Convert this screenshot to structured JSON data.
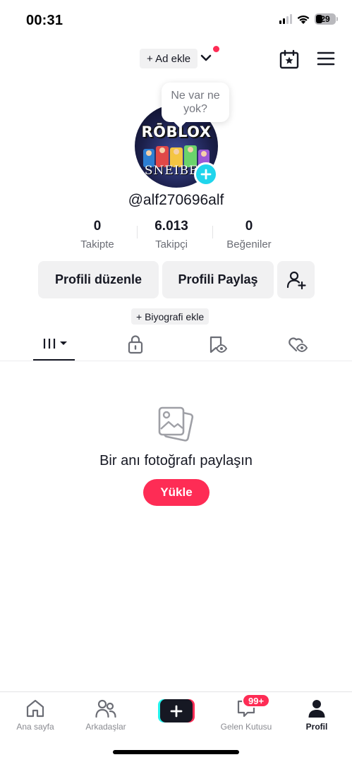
{
  "status_bar": {
    "time": "00:31",
    "battery": "29",
    "icons": [
      "signal-icon",
      "wifi-icon",
      "battery-icon"
    ]
  },
  "top_bar": {
    "add_account_label": "+ Ad ekle",
    "icons": [
      "chevron-down-icon",
      "notification-dot",
      "calendar-star-icon",
      "menu-icon"
    ]
  },
  "profile": {
    "bubble_text": "Ne var ne yok?",
    "avatar_brand": "RŌBLOX",
    "avatar_name": "SNEIBER",
    "username": "@alf270696alf",
    "stats": [
      {
        "value": "0",
        "label": "Takipte"
      },
      {
        "value": "6.013",
        "label": "Takipçi"
      },
      {
        "value": "0",
        "label": "Beğeniler"
      }
    ],
    "buttons": {
      "edit": "Profili düzenle",
      "share": "Profili Paylaş"
    },
    "bio_button": "+ Biyografi ekle"
  },
  "tabs": [
    {
      "name": "videos",
      "icon": "grid-icon",
      "active": true
    },
    {
      "name": "private",
      "icon": "lock-icon",
      "active": false
    },
    {
      "name": "saved",
      "icon": "bookmark-eye-icon",
      "active": false
    },
    {
      "name": "liked",
      "icon": "heart-eye-icon",
      "active": false
    }
  ],
  "empty_state": {
    "title": "Bir anı fotoğrafı paylaşın",
    "button": "Yükle",
    "icon": "photos-icon"
  },
  "bottom_nav": {
    "items": [
      {
        "label": "Ana sayfa",
        "icon": "home-icon"
      },
      {
        "label": "Arkadaşlar",
        "icon": "friends-icon"
      },
      {
        "label": "",
        "icon": "create-plus-icon"
      },
      {
        "label": "Gelen Kutusu",
        "icon": "inbox-icon"
      },
      {
        "label": "Profil",
        "icon": "profile-icon"
      }
    ],
    "inbox_badge": "99+"
  },
  "colors": {
    "accent": "#fe2c55",
    "cyan": "#25f4ee",
    "plus_badge": "#20d5ec",
    "text": "#161823",
    "muted": "#8a8b91",
    "button_bg": "#f1f1f2"
  }
}
